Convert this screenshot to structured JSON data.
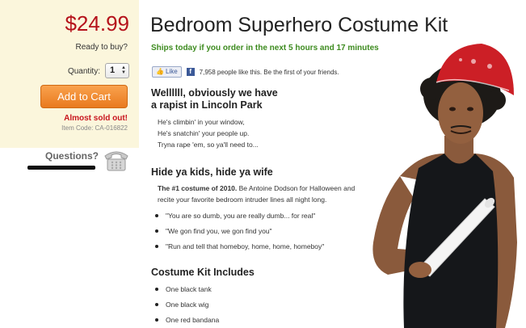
{
  "buybox": {
    "price": "$24.99",
    "ready_label": "Ready to buy?",
    "quantity_label": "Quantity:",
    "quantity_value": "1",
    "add_to_cart": "Add to Cart",
    "almost_sold_out": "Almost sold out!",
    "item_code": "Item Code: CA-016822"
  },
  "support": {
    "questions": "Questions?",
    "phone_icon": "phone-icon"
  },
  "product": {
    "title": "Bedroom Superhero Costume Kit",
    "shipping_notice": "Ships today if you order in the next 5 hours and 17 minutes"
  },
  "social": {
    "like_label": "Like",
    "like_text": "7,958 people like this.  Be the first of your friends."
  },
  "section1": {
    "heading_line1": "Wellllll, obviously we have",
    "heading_line2": "a rapist in Lincoln Park",
    "lyrics": [
      "He's climbin' in your window,",
      "He's snatchin' your people up.",
      "Tryna rape 'em, so ya'll need to..."
    ]
  },
  "section2": {
    "heading": "Hide ya kids, hide ya wife",
    "intro_bold": "The #1 costume of 2010.",
    "intro_line1_rest": " Be Antoine Dodson for Halloween and",
    "intro_line2": "recite your favorite bedroom intruder lines all night long.",
    "quotes": [
      "\"You are so dumb, you are really dumb... for real\"",
      "\"We gon find you, we gon find you\"",
      "\"Run and tell that homeboy, home, home, homeboy\""
    ]
  },
  "section3": {
    "heading": "Costume Kit Includes",
    "items": [
      "One black tank",
      "One black wig",
      "One red bandana"
    ]
  },
  "colors": {
    "price_red": "#b5121b",
    "ship_green": "#3d8b1f",
    "cart_orange": "#ef8a2c",
    "buybox_bg": "#fbf6dc",
    "bandana_red": "#cc1f26"
  }
}
